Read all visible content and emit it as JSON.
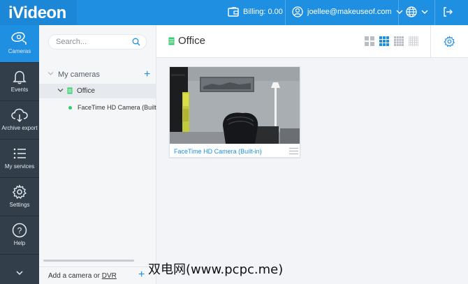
{
  "app": {
    "logo": "iVideon"
  },
  "topbar": {
    "billing": "Billing: 0.00",
    "account_email": "joellee@makeuseof.com"
  },
  "leftnav": {
    "items": [
      {
        "label": "Cameras",
        "icon": "cameras-icon",
        "active": true
      },
      {
        "label": "Events",
        "icon": "bell-icon",
        "active": false
      },
      {
        "label": "Archive export",
        "icon": "cloud-download-icon",
        "active": false
      },
      {
        "label": "My services",
        "icon": "list-icon",
        "active": false
      },
      {
        "label": "Settings",
        "icon": "gear-icon",
        "active": false
      },
      {
        "label": "Help",
        "icon": "help-icon",
        "active": false
      }
    ]
  },
  "sidebar": {
    "search_placeholder": "Search...",
    "tree_header": "My cameras",
    "folder": "Office",
    "camera": "FaceTime HD Camera (Built-in)",
    "footer_prefix": "Add a camera or ",
    "footer_link": "DVR"
  },
  "main": {
    "title": "Office",
    "cameras": [
      {
        "name": "FaceTime HD Camera (Built-in)"
      }
    ]
  },
  "watermark": "双电网(www.pcpc.me)",
  "colors": {
    "brand": "#1e8fe1",
    "nav_bg": "#323e4a",
    "online": "#2fce6a"
  }
}
